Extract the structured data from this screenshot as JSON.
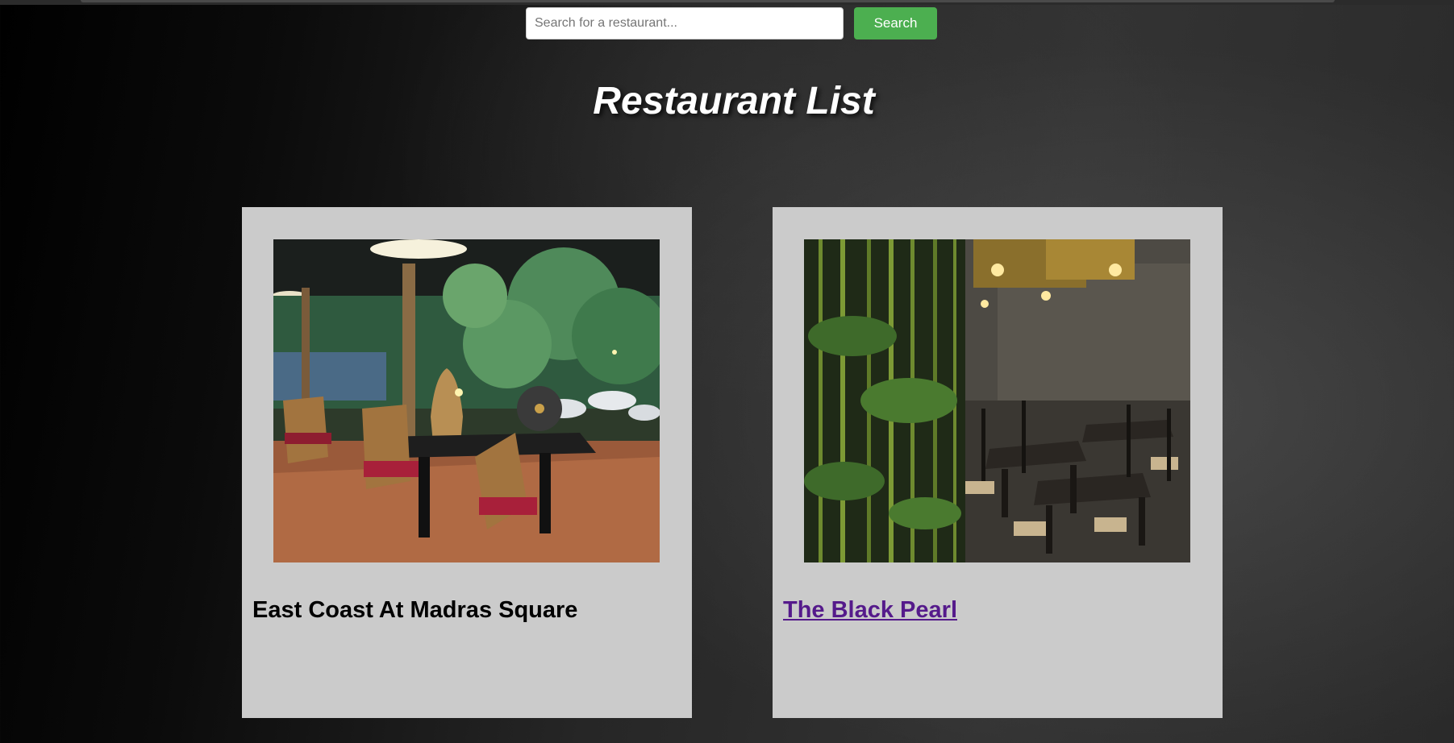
{
  "search": {
    "placeholder": "Search for a restaurant...",
    "value": "",
    "button_label": "Search"
  },
  "page": {
    "title": "Restaurant List"
  },
  "restaurants": [
    {
      "name": "East Coast At Madras Square",
      "image_icon": "outdoor-patio-dining-photo",
      "is_link": false
    },
    {
      "name": "The Black Pearl",
      "image_icon": "bamboo-interior-dining-photo",
      "is_link": true,
      "link_color": "#551a8b"
    }
  ],
  "colors": {
    "search_button": "#4caf50",
    "card_background": "#cbcbcb",
    "title": "#ffffff"
  }
}
